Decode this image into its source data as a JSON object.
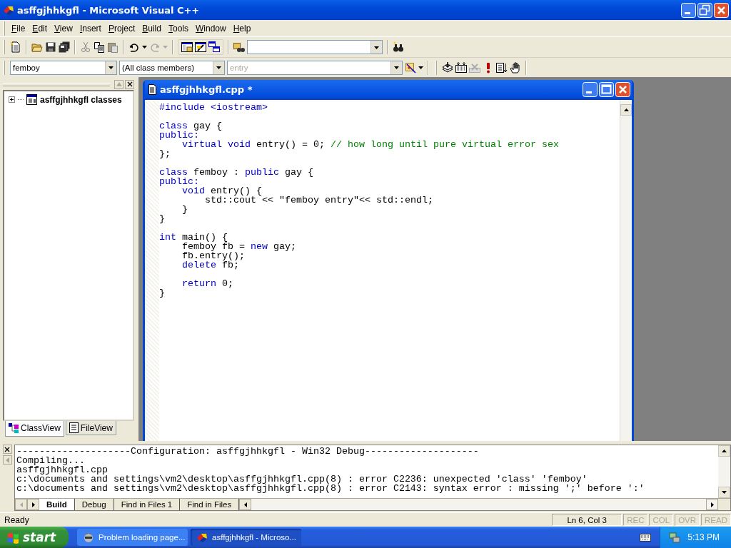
{
  "window": {
    "title": "asffgjhhkgfl - Microsoft Visual C++"
  },
  "menu": [
    {
      "label": "File"
    },
    {
      "label": "Edit"
    },
    {
      "label": "View"
    },
    {
      "label": "Insert"
    },
    {
      "label": "Project"
    },
    {
      "label": "Build"
    },
    {
      "label": "Tools"
    },
    {
      "label": "Window"
    },
    {
      "label": "Help"
    }
  ],
  "wizard_bar": {
    "class_combo": "femboy",
    "filter_combo": "(All class members)",
    "members_combo": {
      "value": "entry",
      "disabled": true
    }
  },
  "class_pane": {
    "tree": [
      {
        "label": "asffgjhhkgfl classes",
        "expanded": false
      }
    ],
    "tabs": [
      {
        "label": "ClassView",
        "selected": true
      },
      {
        "label": "FileView",
        "selected": false
      }
    ]
  },
  "editor": {
    "title": "asffgjhhkgfl.cpp *",
    "lines": [
      {
        "kind": "code",
        "tokens": [
          {
            "kind": "keyword",
            "text": "#include <iostream>"
          }
        ]
      },
      {
        "kind": "blank"
      },
      {
        "kind": "code",
        "tokens": [
          {
            "kind": "keyword",
            "text": "class"
          },
          {
            "kind": "plain",
            "text": " gay {"
          }
        ]
      },
      {
        "kind": "code",
        "tokens": [
          {
            "kind": "keyword",
            "text": "public:"
          }
        ]
      },
      {
        "kind": "code",
        "tokens": [
          {
            "kind": "keyword",
            "text": "    virtual void"
          },
          {
            "kind": "plain",
            "text": " entry() = 0; "
          },
          {
            "kind": "comment",
            "text": "// how long until pure virtual error sex"
          }
        ]
      },
      {
        "kind": "code",
        "tokens": [
          {
            "kind": "plain",
            "text": "};"
          }
        ]
      },
      {
        "kind": "blank"
      },
      {
        "kind": "code",
        "tokens": [
          {
            "kind": "keyword",
            "text": "class"
          },
          {
            "kind": "plain",
            "text": " femboy : "
          },
          {
            "kind": "keyword",
            "text": "public"
          },
          {
            "kind": "plain",
            "text": " gay {"
          }
        ]
      },
      {
        "kind": "code",
        "tokens": [
          {
            "kind": "keyword",
            "text": "public:"
          }
        ]
      },
      {
        "kind": "code",
        "tokens": [
          {
            "kind": "keyword",
            "text": "    void"
          },
          {
            "kind": "plain",
            "text": " entry() {"
          }
        ]
      },
      {
        "kind": "code",
        "tokens": [
          {
            "kind": "plain",
            "text": "        std::cout << \"femboy entry\"<< std::endl;"
          }
        ]
      },
      {
        "kind": "code",
        "tokens": [
          {
            "kind": "plain",
            "text": "    }"
          }
        ]
      },
      {
        "kind": "code",
        "tokens": [
          {
            "kind": "plain",
            "text": "}"
          }
        ]
      },
      {
        "kind": "blank"
      },
      {
        "kind": "code",
        "tokens": [
          {
            "kind": "keyword",
            "text": "int"
          },
          {
            "kind": "plain",
            "text": " main() {"
          }
        ]
      },
      {
        "kind": "code",
        "tokens": [
          {
            "kind": "plain",
            "text": "    femboy fb = "
          },
          {
            "kind": "keyword",
            "text": "new"
          },
          {
            "kind": "plain",
            "text": " gay;"
          }
        ]
      },
      {
        "kind": "code",
        "tokens": [
          {
            "kind": "plain",
            "text": "    fb.entry();"
          }
        ]
      },
      {
        "kind": "code",
        "tokens": [
          {
            "kind": "keyword",
            "text": "    delete"
          },
          {
            "kind": "plain",
            "text": " fb;"
          }
        ]
      },
      {
        "kind": "blank"
      },
      {
        "kind": "code",
        "tokens": [
          {
            "kind": "keyword",
            "text": "    return"
          },
          {
            "kind": "plain",
            "text": " 0;"
          }
        ]
      },
      {
        "kind": "code",
        "tokens": [
          {
            "kind": "plain",
            "text": "}"
          }
        ]
      }
    ]
  },
  "output": {
    "lines": [
      "--------------------Configuration: asffgjhhkgfl - Win32 Debug--------------------",
      "Compiling...",
      "asffgjhhkgfl.cpp",
      "c:\\documents and settings\\vm2\\desktop\\asffgjhhkgfl.cpp(8) : error C2236: unexpected 'class' 'femboy'",
      "c:\\documents and settings\\vm2\\desktop\\asffgjhhkgfl.cpp(8) : error C2143: syntax error : missing ';' before ':'"
    ],
    "tabs": [
      {
        "label": "Build",
        "selected": true
      },
      {
        "label": "Debug",
        "selected": false
      },
      {
        "label": "Find in Files 1",
        "selected": false
      },
      {
        "label": "Find in Files",
        "selected": false
      }
    ]
  },
  "status_bar": {
    "message": "Ready",
    "position": "Ln 6, Col 3",
    "indicators": [
      {
        "label": "REC",
        "disabled": true
      },
      {
        "label": "COL",
        "disabled": true
      },
      {
        "label": "OVR",
        "disabled": true
      },
      {
        "label": "READ",
        "disabled": true
      }
    ]
  },
  "taskbar": {
    "start": "start",
    "tasks": [
      {
        "label": "Problem loading page...",
        "selected": false
      },
      {
        "label": "asffgjhhkgfl - Microso...",
        "selected": true
      }
    ],
    "clock": "5:13 PM"
  }
}
